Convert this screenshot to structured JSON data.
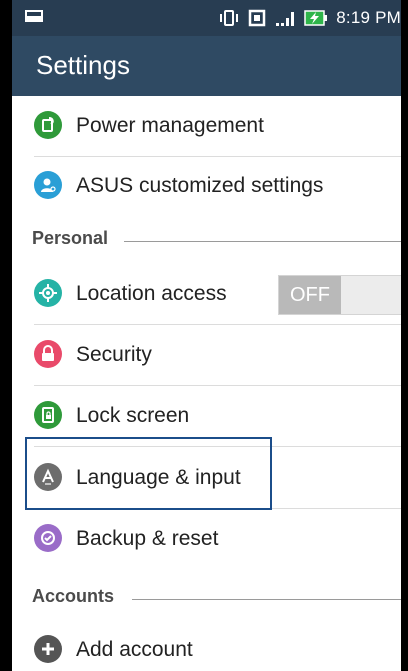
{
  "status_bar": {
    "time": "8:19 PM",
    "icons": [
      "image-icon",
      "vibrate-icon",
      "sim-icon",
      "signal-icon",
      "battery-charging-icon"
    ]
  },
  "app_bar": {
    "title": "Settings"
  },
  "items": [
    {
      "label": "Power management",
      "icon": "power-management-icon",
      "color": "#2f9a3a"
    },
    {
      "label": "ASUS customized settings",
      "icon": "asus-settings-icon",
      "color": "#2a9fd6"
    },
    {
      "label": "Location access",
      "icon": "location-icon",
      "color": "#25b3a6",
      "toggle": "OFF"
    },
    {
      "label": "Security",
      "icon": "lock-icon",
      "color": "#e94a6a"
    },
    {
      "label": "Lock screen",
      "icon": "lock-screen-icon",
      "color": "#2f9a3a"
    },
    {
      "label": "Language & input",
      "icon": "language-icon",
      "color": "#6d6d6d"
    },
    {
      "label": "Backup & reset",
      "icon": "backup-icon",
      "color": "#9a6cc8"
    },
    {
      "label": "Add account",
      "icon": "add-account-icon",
      "color": "#555555"
    }
  ],
  "sections": {
    "personal": "Personal",
    "accounts": "Accounts"
  }
}
